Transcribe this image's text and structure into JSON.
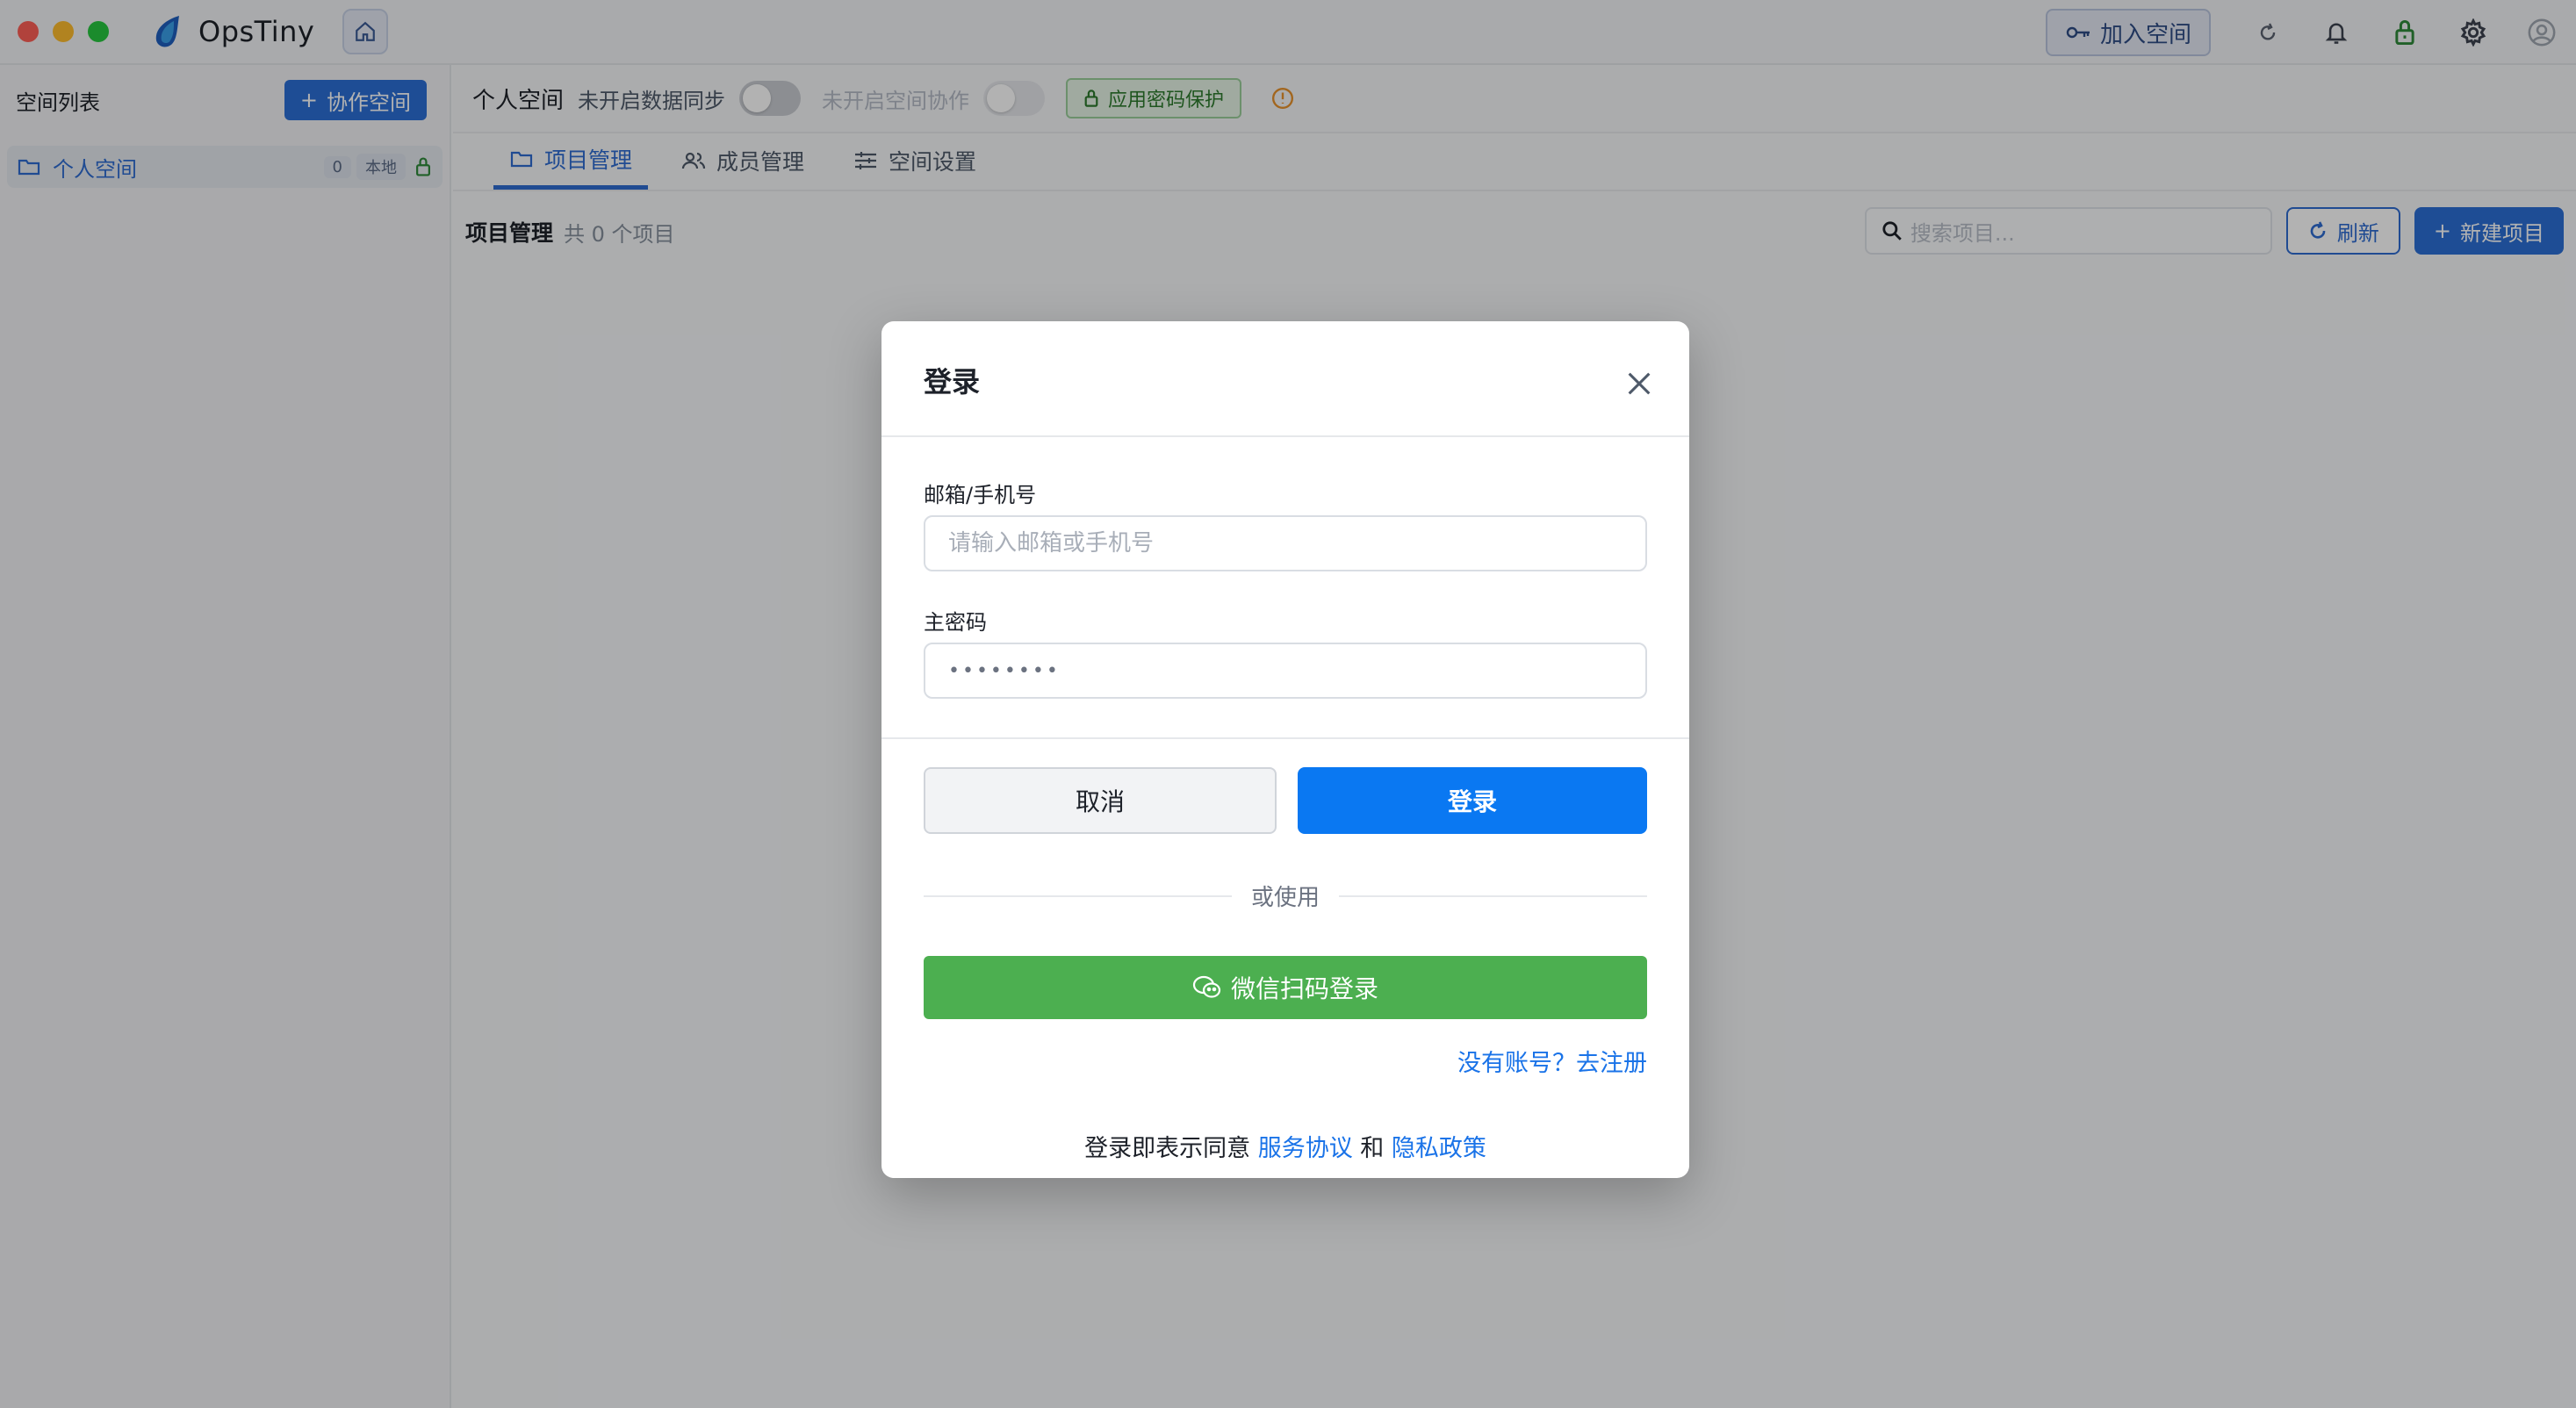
{
  "window": {
    "app_name": "OpsTiny"
  },
  "titlebar": {
    "join_space_label": "加入空间"
  },
  "sidebar": {
    "title": "空间列表",
    "collab_button_label": "协作空间",
    "items": [
      {
        "label": "个人空间",
        "count": "0",
        "tag": "本地"
      }
    ]
  },
  "main": {
    "header": {
      "space_name": "个人空间",
      "sync_status": "未开启数据同步",
      "collab_status": "未开启空间协作",
      "protect_label": "应用密码保护"
    },
    "tabs": [
      {
        "label": "项目管理",
        "active": true
      },
      {
        "label": "成员管理",
        "active": false
      },
      {
        "label": "空间设置",
        "active": false
      }
    ],
    "toolbar": {
      "title": "项目管理",
      "count_text": "共 0 个项目",
      "search_placeholder": "搜索项目...",
      "refresh_label": "刷新",
      "new_label": "新建项目"
    }
  },
  "login_modal": {
    "title": "登录",
    "account_label": "邮箱/手机号",
    "account_placeholder": "请输入邮箱或手机号",
    "password_label": "主密码",
    "password_dots": "••••••••",
    "cancel_label": "取消",
    "login_label": "登录",
    "or_text": "或使用",
    "wechat_label": "微信扫码登录",
    "register_text": "没有账号？去注册",
    "agree_prefix": "登录即表示同意",
    "terms_link": "服务协议",
    "and_text": "和",
    "privacy_link": "隐私政策"
  },
  "colors": {
    "primary": "#0a78f2",
    "wechat": "#4caf50",
    "link": "#1a73e8"
  }
}
